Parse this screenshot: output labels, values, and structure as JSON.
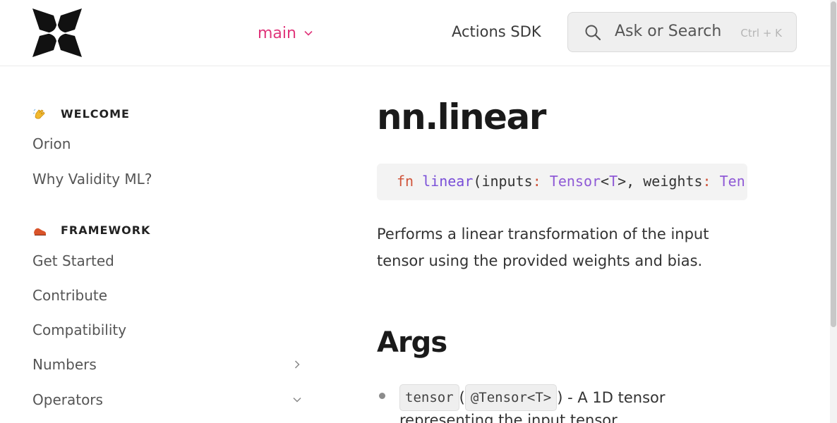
{
  "header": {
    "logo_icon": "orion-star-logo-icon",
    "branch_label": "main",
    "nav_link": "Actions SDK",
    "search": {
      "placeholder": "Ask or Search",
      "shortcut": "Ctrl + K"
    }
  },
  "sidebar": {
    "sections": [
      {
        "title": "WELCOME",
        "emoji": "waving-hand-icon",
        "items": [
          {
            "label": "Orion"
          },
          {
            "label": "Why Validity ML?"
          }
        ]
      },
      {
        "title": "FRAMEWORK",
        "emoji": "shoe-icon",
        "items": [
          {
            "label": "Get Started"
          },
          {
            "label": "Contribute"
          },
          {
            "label": "Compatibility"
          },
          {
            "label": "Numbers",
            "chevron": "right"
          },
          {
            "label": "Operators",
            "chevron": "down"
          }
        ]
      }
    ]
  },
  "main": {
    "title": "nn.linear",
    "code": {
      "keyword": "fn",
      "fn_name": "linear",
      "open_paren": "(",
      "param1": "inputs",
      "colon": ":",
      "type1": "Tensor",
      "lt": "<",
      "generic": "T",
      "gt_comma": ">, ",
      "param2": "weights",
      "colon2": ":",
      "type2_partial": " Ten"
    },
    "description": "Performs a linear transformation of the input tensor using the provided weights and bias.",
    "args_heading": "Args",
    "args": [
      {
        "name": "tensor",
        "open": "(",
        "type": "@Tensor<T>",
        "close_desc": ") - A 1D tensor",
        "line2": "representing the input tensor."
      }
    ]
  },
  "colors": {
    "accent_pink": "#e0357a",
    "code_keyword": "#d0543a",
    "code_purple": "#7a4fd8"
  }
}
